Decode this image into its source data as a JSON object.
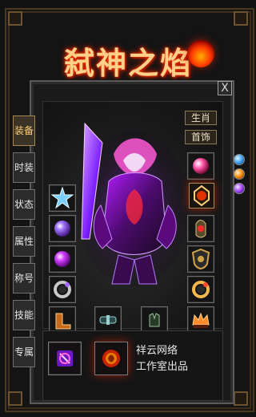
{
  "title": "弑神之焰",
  "close_label": "X",
  "side_tabs": [
    {
      "label": "装备"
    },
    {
      "label": "时装"
    },
    {
      "label": "状态"
    },
    {
      "label": "属性"
    },
    {
      "label": "称号"
    },
    {
      "label": "技能"
    },
    {
      "label": "专属"
    }
  ],
  "top_right_buttons": [
    {
      "label": "生肖"
    },
    {
      "label": "首饰"
    }
  ],
  "side_gem_icons": [
    "blue-gem-icon",
    "orange-gem-icon",
    "purple-gem-icon"
  ],
  "equipment_slots": [
    {
      "name": "left-slot-1",
      "icon": "star-icon"
    },
    {
      "name": "left-slot-2",
      "icon": "helmet-icon"
    },
    {
      "name": "left-slot-3",
      "icon": "beast-icon"
    },
    {
      "name": "left-slot-4",
      "icon": "ring-icon"
    },
    {
      "name": "left-slot-5",
      "icon": "boots-icon"
    },
    {
      "name": "right-slot-1",
      "icon": "armor-icon"
    },
    {
      "name": "right-slot-2",
      "icon": "medal-icon"
    },
    {
      "name": "right-slot-3",
      "icon": "bracer-icon"
    },
    {
      "name": "right-slot-4",
      "icon": "shield-icon"
    },
    {
      "name": "right-slot-5",
      "icon": "ring-icon"
    },
    {
      "name": "right-slot-6",
      "icon": "crown-icon"
    },
    {
      "name": "bottom-slot-1",
      "icon": "belt-icon"
    },
    {
      "name": "bottom-slot-2",
      "icon": "glove-icon"
    }
  ],
  "bottom_items": [
    {
      "name": "rune-book-item",
      "icon": "rune-book-icon"
    },
    {
      "name": "fire-orb-item",
      "icon": "fire-orb-icon"
    }
  ],
  "studio_text": [
    "祥云网络",
    "工作室出品"
  ],
  "colors": {
    "accent_gold": "#ffcf7a",
    "flame_red": "#ff3a00",
    "panel_border": "#5a5a5a"
  }
}
